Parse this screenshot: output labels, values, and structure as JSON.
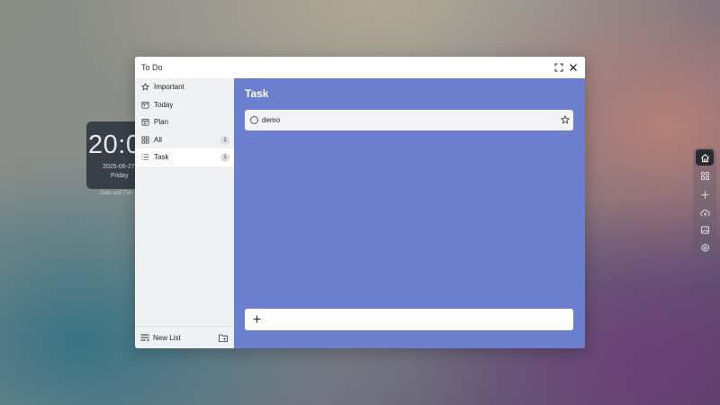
{
  "desktop": {
    "clock": {
      "time": "20:0",
      "date": "2025-06-27",
      "day": "Friday",
      "caption": "Date and Tim"
    },
    "dock": [
      {
        "icon": "home-icon",
        "active": true
      },
      {
        "icon": "apps-icon"
      },
      {
        "icon": "plus-icon"
      },
      {
        "icon": "cloud-upload-icon"
      },
      {
        "icon": "image-icon"
      },
      {
        "icon": "gear-icon"
      }
    ]
  },
  "window": {
    "title": "To Do",
    "controls": {
      "maximize": "maximize-icon",
      "close": "close-icon"
    }
  },
  "sidebar": {
    "items": [
      {
        "label": "Important",
        "icon": "star-icon",
        "count": ""
      },
      {
        "label": "Today",
        "icon": "calendar-icon",
        "count": ""
      },
      {
        "label": "Plan",
        "icon": "calendar-plan-icon",
        "count": ""
      },
      {
        "label": "All",
        "icon": "grid-icon",
        "count": "1"
      },
      {
        "label": "Task",
        "icon": "list-icon",
        "count": "1",
        "active": true
      }
    ],
    "footer": {
      "new_list_label": "New List"
    }
  },
  "main": {
    "title": "Task",
    "background": "#6b7fce",
    "tasks": [
      {
        "title": "demo",
        "important": false
      }
    ],
    "add_task": {
      "value": "",
      "placeholder": ""
    }
  }
}
